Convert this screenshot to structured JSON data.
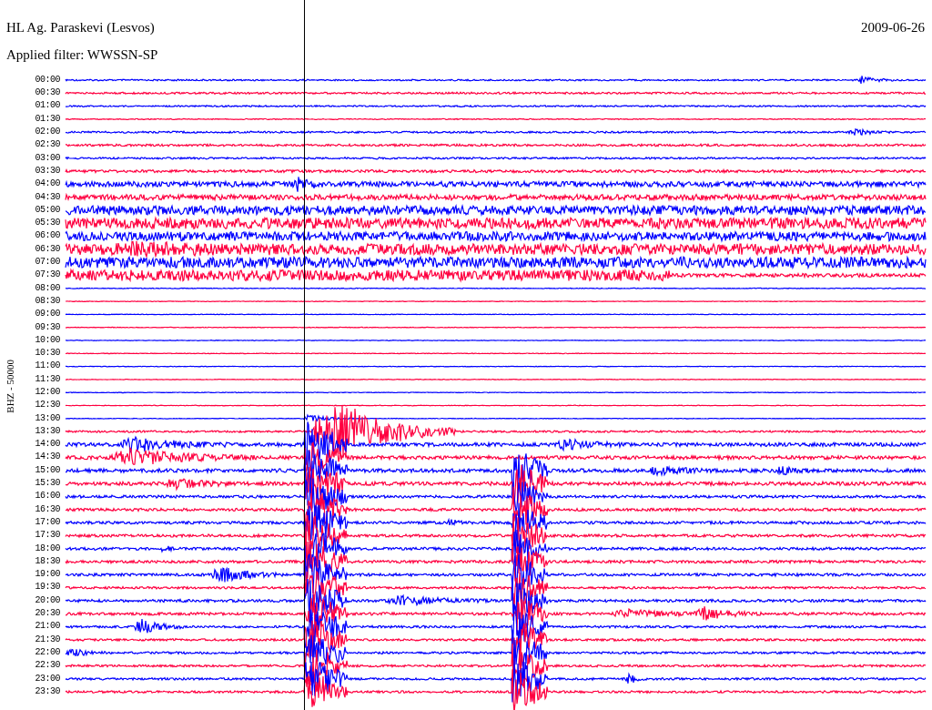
{
  "title": "HL Ag. Paraskevi (Lesvos)",
  "filter": "Applied filter: WWSSN-SP",
  "date": "2009-06-26",
  "channel_label": "BHZ - 50000",
  "traces": [
    {
      "label": "00:00",
      "color": "#0000ff"
    },
    {
      "label": "00:30",
      "color": "#ff0040"
    },
    {
      "label": "01:00",
      "color": "#0000ff"
    },
    {
      "label": "01:30",
      "color": "#ff0040"
    },
    {
      "label": "02:00",
      "color": "#0000ff"
    },
    {
      "label": "02:30",
      "color": "#ff0040"
    },
    {
      "label": "03:00",
      "color": "#0000ff"
    },
    {
      "label": "03:30",
      "color": "#ff0040"
    },
    {
      "label": "04:00",
      "color": "#0000ff"
    },
    {
      "label": "04:30",
      "color": "#ff0040"
    },
    {
      "label": "05:00",
      "color": "#0000ff"
    },
    {
      "label": "05:30",
      "color": "#ff0040"
    },
    {
      "label": "06:00",
      "color": "#0000ff"
    },
    {
      "label": "06:30",
      "color": "#ff0040"
    },
    {
      "label": "07:00",
      "color": "#0000ff"
    },
    {
      "label": "07:30",
      "color": "#ff0040"
    },
    {
      "label": "08:00",
      "color": "#0000ff"
    },
    {
      "label": "08:30",
      "color": "#ff0040"
    },
    {
      "label": "09:00",
      "color": "#0000ff"
    },
    {
      "label": "09:30",
      "color": "#ff0040"
    },
    {
      "label": "10:00",
      "color": "#0000ff"
    },
    {
      "label": "10:30",
      "color": "#ff0040"
    },
    {
      "label": "11:00",
      "color": "#0000ff"
    },
    {
      "label": "11:30",
      "color": "#ff0040"
    },
    {
      "label": "12:00",
      "color": "#0000ff"
    },
    {
      "label": "12:30",
      "color": "#ff0040"
    },
    {
      "label": "13:00",
      "color": "#0000ff"
    },
    {
      "label": "13:30",
      "color": "#ff0040"
    },
    {
      "label": "14:00",
      "color": "#0000ff"
    },
    {
      "label": "14:30",
      "color": "#ff0040"
    },
    {
      "label": "15:00",
      "color": "#0000ff"
    },
    {
      "label": "15:30",
      "color": "#ff0040"
    },
    {
      "label": "16:00",
      "color": "#0000ff"
    },
    {
      "label": "16:30",
      "color": "#ff0040"
    },
    {
      "label": "17:00",
      "color": "#0000ff"
    },
    {
      "label": "17:30",
      "color": "#ff0040"
    },
    {
      "label": "18:00",
      "color": "#0000ff"
    },
    {
      "label": "18:30",
      "color": "#ff0040"
    },
    {
      "label": "19:00",
      "color": "#0000ff"
    },
    {
      "label": "19:30",
      "color": "#ff0040"
    },
    {
      "label": "20:00",
      "color": "#0000ff"
    },
    {
      "label": "20:30",
      "color": "#ff0040"
    },
    {
      "label": "21:00",
      "color": "#0000ff"
    },
    {
      "label": "21:30",
      "color": "#ff0040"
    },
    {
      "label": "22:00",
      "color": "#0000ff"
    },
    {
      "label": "22:30",
      "color": "#ff0040"
    },
    {
      "label": "23:00",
      "color": "#0000ff"
    },
    {
      "label": "23:30",
      "color": "#ff0040"
    }
  ]
}
